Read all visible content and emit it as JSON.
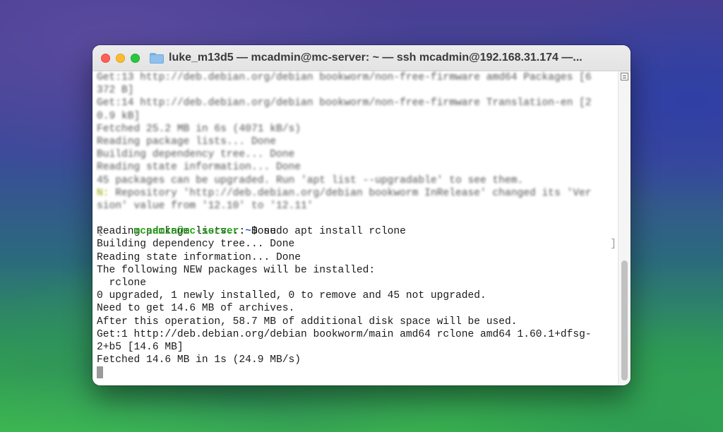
{
  "window": {
    "title": "luke_m13d5 — mcadmin@mc-server: ~ — ssh mcadmin@192.168.31.174 —..."
  },
  "terminal": {
    "blurred_lines": [
      "Get:13 http://deb.debian.org/debian bookworm/non-free-firmware amd64 Packages [6",
      "372 B]",
      "Get:14 http://deb.debian.org/debian bookworm/non-free-firmware Translation-en [2",
      "0.9 kB]",
      "Fetched 25.2 MB in 6s (4071 kB/s)",
      "Reading package lists... Done",
      "Building dependency tree... Done",
      "Reading state information... Done",
      "45 packages can be upgraded. Run 'apt list --upgradable' to see them."
    ],
    "warning_prefix": "N:",
    "warning_line1": " Repository 'http://deb.debian.org/debian bookworm InRelease' changed its 'Ver",
    "warning_line2": "sion' value from '12.10' to '12.11'",
    "prompt_user": "mcadmin@mc-server",
    "prompt_sep": ":",
    "prompt_path": "~",
    "prompt_symbol": "$ ",
    "command": "sudo apt install rclone",
    "output_lines": [
      "Reading package lists... Done",
      "Building dependency tree... Done",
      "Reading state information... Done",
      "The following NEW packages will be installed:",
      "  rclone",
      "0 upgraded, 1 newly installed, 0 to remove and 45 not upgraded.",
      "Need to get 14.6 MB of archives.",
      "After this operation, 58.7 MB of additional disk space will be used.",
      "Get:1 http://deb.debian.org/debian bookworm/main amd64 rclone amd64 1.60.1+dfsg-",
      "2+b5 [14.6 MB]",
      "Fetched 14.6 MB in 1s (24.9 MB/s)"
    ],
    "bracket_left": "[",
    "bracket_right": "]"
  }
}
